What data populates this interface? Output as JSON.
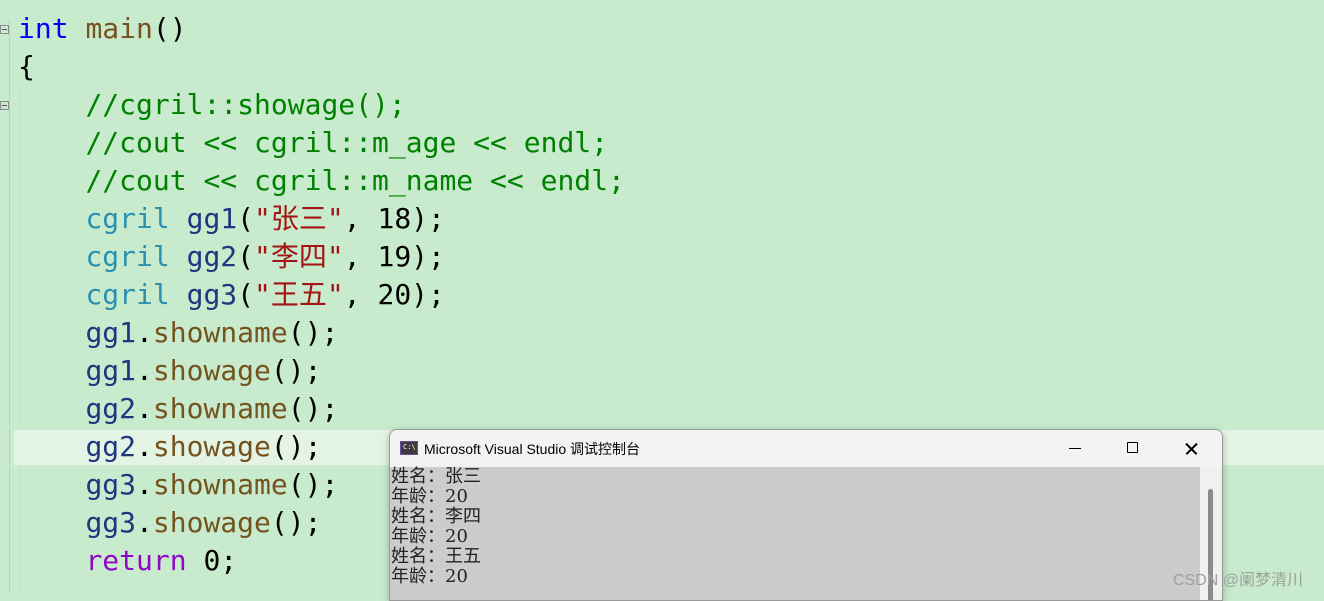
{
  "code": {
    "line1": {
      "type": "int",
      "fn": "main",
      "rest": "()"
    },
    "line2": "{",
    "line3": "//cgril::showage();",
    "line4": "//cout << cgril::m_age << endl;",
    "line5": "//cout << cgril::m_name << endl;",
    "decl": [
      {
        "type": "cgril",
        "var": "gg1",
        "open": "(",
        "str": "\"张三\"",
        "rest": ", 18);"
      },
      {
        "type": "cgril",
        "var": "gg2",
        "open": "(",
        "str": "\"李四\"",
        "rest": ", 19);"
      },
      {
        "type": "cgril",
        "var": "gg3",
        "open": "(",
        "str": "\"王五\"",
        "rest": ", 20);"
      }
    ],
    "calls": [
      {
        "var": "gg1",
        "dot": ".",
        "fn": "showname",
        "rest": "();"
      },
      {
        "var": "gg1",
        "dot": ".",
        "fn": "showage",
        "rest": "();"
      },
      {
        "var": "gg2",
        "dot": ".",
        "fn": "showname",
        "rest": "();"
      },
      {
        "var": "gg2",
        "dot": ".",
        "fn": "showage",
        "rest": "();"
      },
      {
        "var": "gg3",
        "dot": ".",
        "fn": "showname",
        "rest": "();"
      },
      {
        "var": "gg3",
        "dot": ".",
        "fn": "showage",
        "rest": "();"
      }
    ],
    "ret": {
      "kw": "return",
      "rest": " 0;"
    }
  },
  "console": {
    "title": "Microsoft Visual Studio 调试控制台",
    "lines": [
      "姓名：张三",
      "年龄：20",
      "姓名：李四",
      "年龄：20",
      "姓名：王五",
      "年龄：20"
    ]
  },
  "watermark": "CSDN @阑梦清川",
  "icons": {
    "console_app": "console-app-icon",
    "minimize": "minimize-icon",
    "maximize": "maximize-icon",
    "close": "close-icon"
  }
}
